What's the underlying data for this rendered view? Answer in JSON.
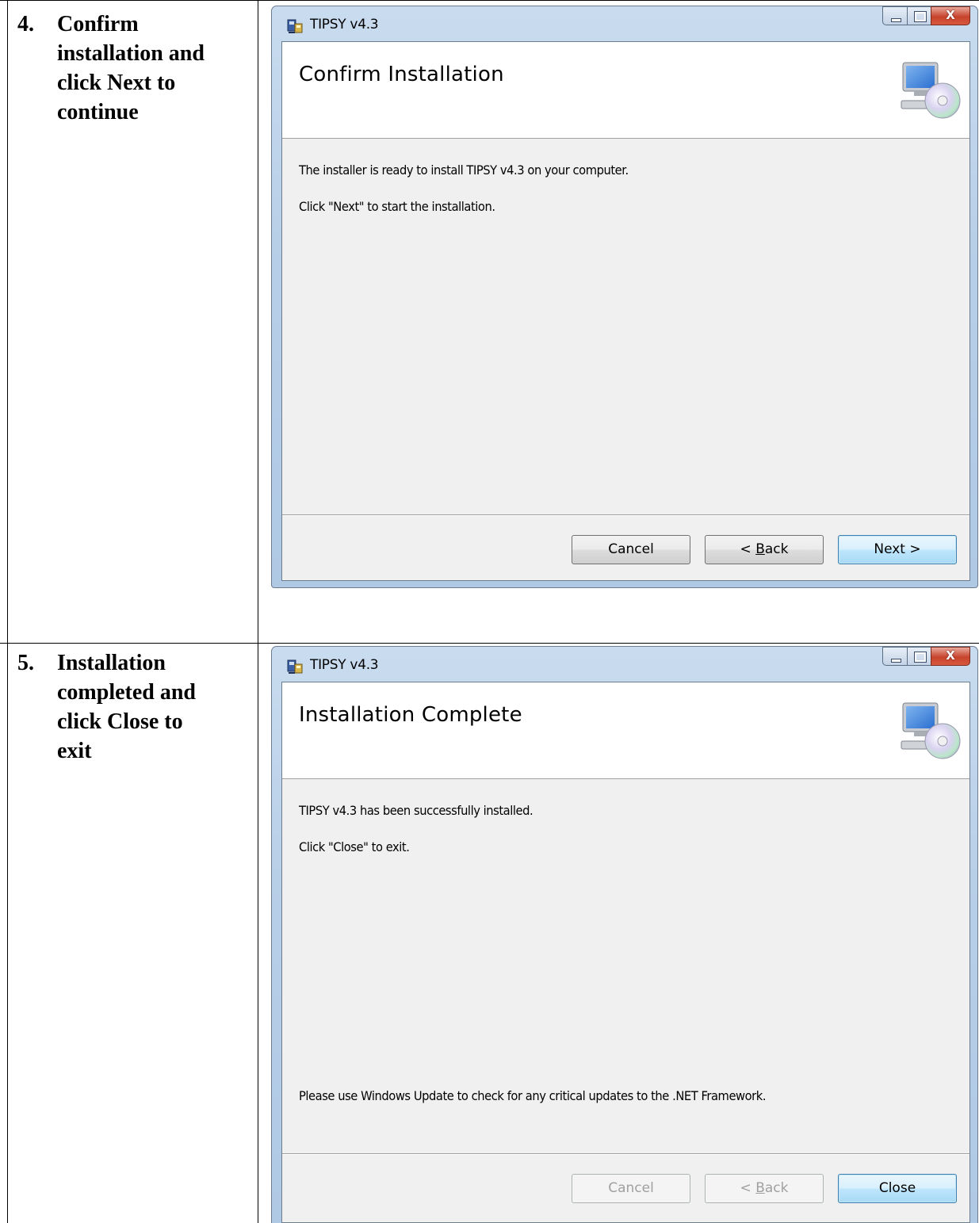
{
  "steps": [
    {
      "number": "4.",
      "lines": [
        "Confirm",
        "installation and",
        "click Next to",
        "continue"
      ],
      "window": {
        "title": "TIPSY v4.3",
        "heading": "Confirm Installation",
        "messages": [
          "The installer is ready to install TIPSY v4.3 on your computer.",
          "Click \"Next\" to start the installation."
        ],
        "footer_message": "",
        "buttons": {
          "cancel": "Cancel",
          "back_prefix": "< ",
          "back_hotkey": "B",
          "back_rest": "ack",
          "next": "Next >"
        }
      }
    },
    {
      "number": "5.",
      "lines": [
        "Installation",
        "completed and",
        "click Close to",
        "exit"
      ],
      "window": {
        "title": "TIPSY v4.3",
        "heading": "Installation Complete",
        "messages": [
          "TIPSY v4.3 has been successfully installed.",
          "Click \"Close\" to exit."
        ],
        "footer_message": "Please use Windows Update to check for any critical updates to the .NET Framework.",
        "buttons": {
          "cancel": "Cancel",
          "back_prefix": "< ",
          "back_hotkey": "B",
          "back_rest": "ack",
          "close": "Close"
        }
      }
    }
  ],
  "caption_buttons": {
    "close_glyph": "X"
  },
  "colors": {
    "primary_button": "#3c7fb1",
    "close_button": "#c7432c",
    "window_frame": "#b8cfe8"
  }
}
